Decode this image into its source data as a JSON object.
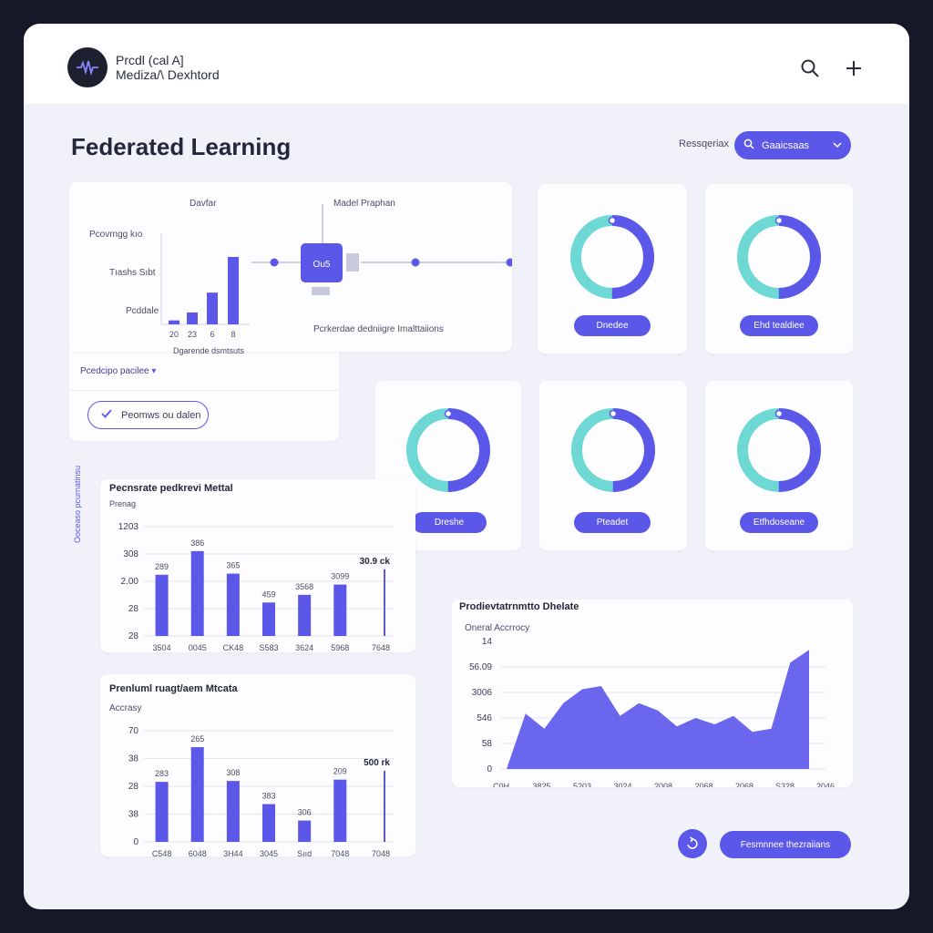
{
  "app": {
    "brand_line1": "Prcdl (cal A]",
    "brand_line2": "Mediza/\\ Dexhtord"
  },
  "header": {
    "page_title": "Federated Learning",
    "responsive_label": "Ressqeriax",
    "dropdown_value": "Gaaicsaas"
  },
  "colors": {
    "accent": "#5b57e8",
    "teal": "#6ed8d4",
    "frame": "#151826",
    "canvas": "#f1f2f9"
  },
  "icons": {
    "search": "search-icon",
    "add": "plus-icon",
    "dropdown": "chevron-down-icon",
    "check": "check-icon",
    "logo": "waveform-icon",
    "fab": "refresh-icon"
  },
  "network_card": {
    "top_label": "Davfar",
    "model_label": "Madel Praphan",
    "node_label": "Ou5",
    "row_labels": [
      "Pcovrngg kıo",
      "Tıаshs Sıbt",
      "Pcddаle"
    ],
    "footer_label": "Pcrkerdae dedniigre Imalttaiions",
    "x_axis_title": "Dgarende dsmtsuts",
    "mini_chart": {
      "type": "bar",
      "categories": [
        "20",
        "23",
        "6",
        "8"
      ],
      "values": [
        1,
        3,
        8,
        17
      ]
    }
  },
  "preview_card": {
    "link_text": "Pcedcipo pacilee",
    "button_label": "Peomws ou dalen"
  },
  "donut_cards": [
    {
      "label": "Dnedee",
      "value": 50
    },
    {
      "label": "Ehd tealdiee",
      "value": 50
    },
    {
      "label": "Dreshe",
      "value": 50
    },
    {
      "label": "Pteadet",
      "value": 50
    },
    {
      "label": "Etfhdoseane",
      "value": 50
    }
  ],
  "side_label": "Ooceaso pcurnatinsu",
  "chart_data": [
    {
      "type": "bar",
      "title": "Pecnsrate pedkrevi Mettal",
      "ylabel": "Prenag",
      "yticks": [
        "1203",
        "308",
        "2.00",
        "28",
        "28"
      ],
      "categories": [
        "3504",
        "0045",
        "CK48",
        "S583",
        "3624",
        "5968",
        "7648"
      ],
      "values": [
        280,
        388,
        285,
        153,
        188,
        235,
        305
      ],
      "value_labels": [
        "289",
        "386",
        "365",
        "459",
        "3568",
        "3099",
        "30.9 ck"
      ],
      "ylim": [
        0,
        500
      ]
    },
    {
      "type": "bar",
      "title": "Prenluml ruagt/aem Mtcata",
      "ylabel": "Accrasy",
      "yticks": [
        "70",
        "38",
        "28",
        "38",
        "0"
      ],
      "categories": [
        "C548",
        "6048",
        "3H44",
        "3045",
        "Sııd",
        "7048",
        "7048"
      ],
      "values": [
        270,
        426,
        274,
        170,
        96,
        280,
        320
      ],
      "value_labels": [
        "283",
        "265",
        "308",
        "383",
        "306",
        "209",
        "500 rk"
      ],
      "ylim": [
        0,
        500
      ]
    },
    {
      "type": "area",
      "title": "Prodievtatrnmtto Dhelate",
      "ylabel": "Oneral Accrrocy",
      "yticks": [
        "14",
        "56.09",
        "3006",
        "546",
        "58",
        "0"
      ],
      "x": [
        "C0H",
        "3825",
        "5203",
        "3024",
        "2008",
        "2068",
        "2068",
        "S328",
        "2046"
      ],
      "values": [
        0,
        52,
        38,
        62,
        75,
        78,
        50,
        62,
        55,
        40,
        48,
        42,
        50,
        35,
        38,
        100,
        112
      ]
    }
  ],
  "footer": {
    "cta_label": "Fesmnnee thezraiians"
  }
}
